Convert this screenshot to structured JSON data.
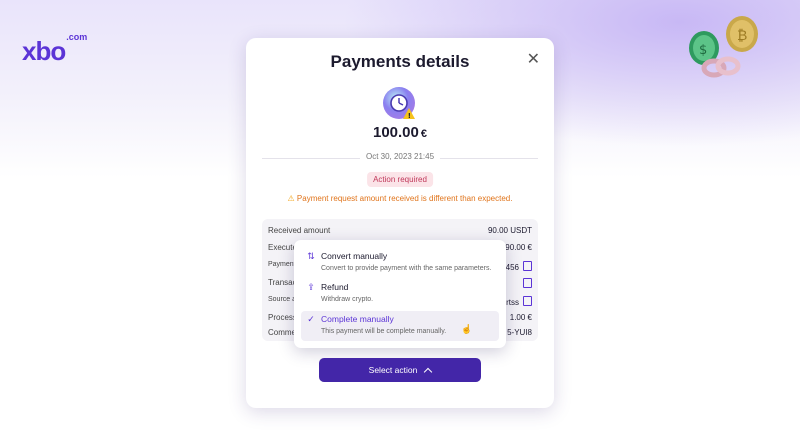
{
  "brand": {
    "logo_text": "xbo",
    "logo_suffix": ".com",
    "accent_color": "#5b34d6"
  },
  "modal": {
    "title": "Payments details",
    "close_icon": "close-icon",
    "amount_value": "100.00",
    "amount_currency": "€",
    "date": "Oct 30, 2023  21:45",
    "status_badge": "Action required",
    "warning_text": "Payment request amount received is different than expected.",
    "details": [
      {
        "key": "Received amount",
        "value": "90.00 USDT",
        "copy": false
      },
      {
        "key": "Executed",
        "value": "90.00 €",
        "copy": false
      },
      {
        "key": "Payment",
        "value": "456",
        "copy": true
      },
      {
        "key": "Transact",
        "value": "",
        "copy": true
      },
      {
        "key": "Source a",
        "value": "rtss",
        "copy": true
      },
      {
        "key": "Process",
        "value": "1.00 €",
        "copy": false
      },
      {
        "key": "Comme",
        "value": "5-YUI8",
        "copy": false
      }
    ]
  },
  "dropdown": {
    "options": [
      {
        "label": "Convert manually",
        "description": "Convert to provide payment with the same parameters.",
        "icon": "convert-icon"
      },
      {
        "label": "Refund",
        "description": "Withdraw crypto.",
        "icon": "refund-icon"
      },
      {
        "label": "Complete manually",
        "description": "This payment will be complete manually.",
        "icon": "checkmark-icon"
      }
    ]
  },
  "action_button": {
    "label": "Select action",
    "icon": "chevron-up-icon"
  }
}
